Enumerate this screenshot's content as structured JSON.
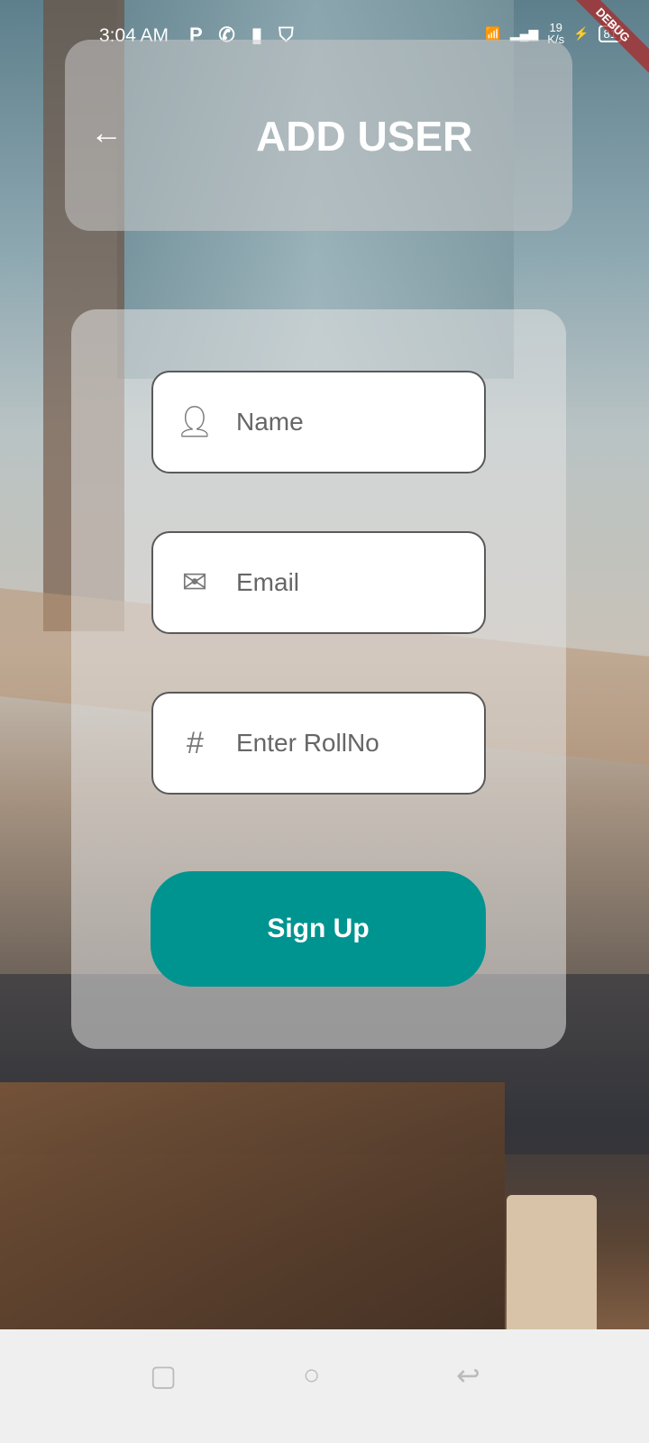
{
  "status": {
    "time": "3:04 AM",
    "speed_value": "19",
    "speed_unit": "K/s",
    "battery": "81",
    "debug": "DEBUG"
  },
  "header": {
    "title": "ADD USER"
  },
  "form": {
    "name_placeholder": "Name",
    "email_placeholder": "Email",
    "rollno_placeholder": "Enter RollNo",
    "submit_label": "Sign Up"
  },
  "colors": {
    "accent": "#009490"
  }
}
